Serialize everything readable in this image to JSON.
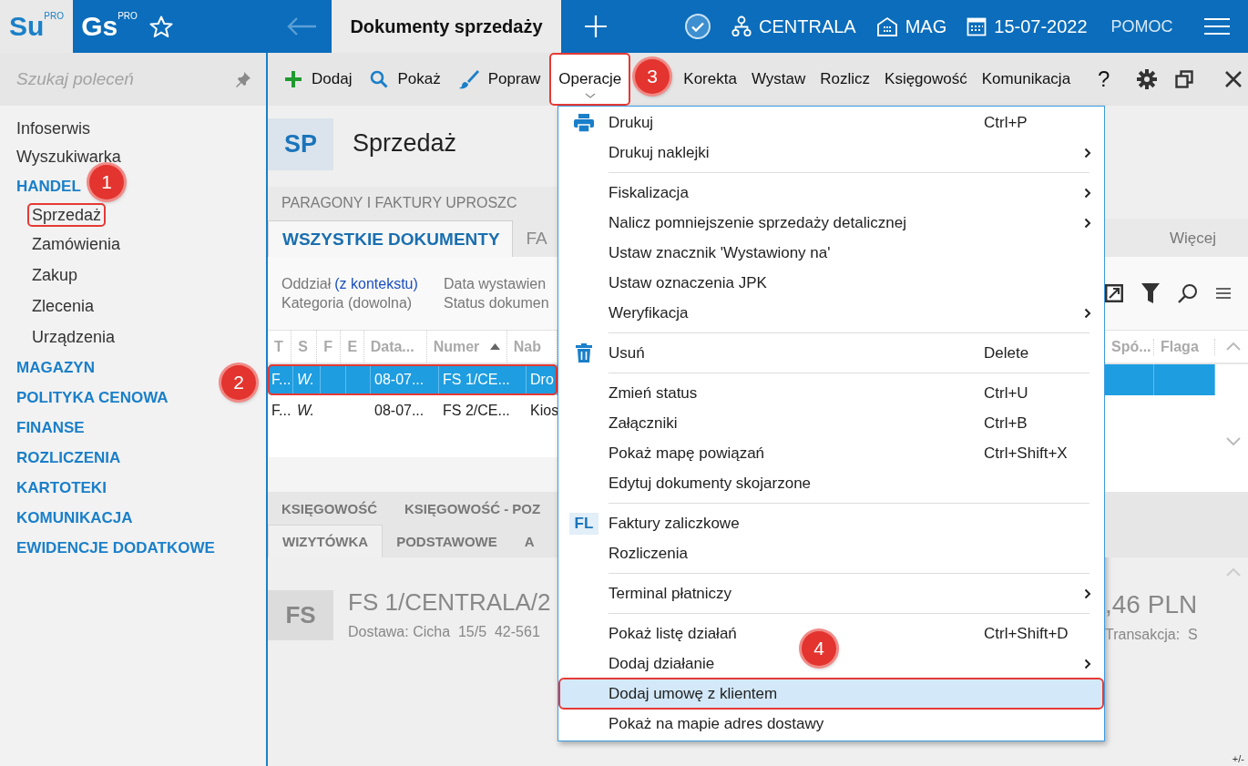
{
  "top_bar": {
    "logos": [
      {
        "text": "Su",
        "badge": "PRO"
      },
      {
        "text": "Gs",
        "badge": "PRO"
      }
    ],
    "tab": "Dokumenty sprzedaży",
    "context": [
      {
        "kind": "branch",
        "label": "CENTRALA"
      },
      {
        "kind": "warehouse",
        "label": "MAG"
      },
      {
        "kind": "date",
        "label": "15-07-2022"
      }
    ],
    "help": "POMOC"
  },
  "sidebar": {
    "search": {
      "placeholder": "Szukaj poleceń"
    },
    "items": [
      {
        "kind": "link",
        "label": "Infoserwis",
        "outlined": false
      },
      {
        "kind": "link",
        "label": "Wyszukiwarka",
        "outlined": false
      },
      {
        "kind": "section",
        "label": "HANDEL",
        "outlined": false,
        "children": [
          {
            "label": "Sprzedaż",
            "outlined": true
          },
          {
            "label": "Zamówienia",
            "outlined": false
          },
          {
            "label": "Zakup",
            "outlined": false
          },
          {
            "label": "Zlecenia",
            "outlined": false
          },
          {
            "label": "Urządzenia",
            "outlined": false
          }
        ]
      },
      {
        "kind": "section",
        "label": "MAGAZYN",
        "outlined": false
      },
      {
        "kind": "section",
        "label": "POLITYKA CENOWA",
        "outlined": false
      },
      {
        "kind": "section",
        "label": "FINANSE",
        "outlined": false
      },
      {
        "kind": "section",
        "label": "ROZLICZENIA",
        "outlined": false
      },
      {
        "kind": "section",
        "label": "KARTOTEKI",
        "outlined": false
      },
      {
        "kind": "section",
        "label": "KOMUNIKACJA",
        "outlined": false
      },
      {
        "kind": "section",
        "label": "EWIDENCJE DODATKOWE",
        "outlined": false
      }
    ]
  },
  "toolbar": {
    "actions": [
      {
        "label": "Dodaj",
        "open": false,
        "outlined": false
      },
      {
        "label": "Pokaż",
        "open": false,
        "outlined": false
      },
      {
        "label": "Popraw",
        "open": false,
        "outlined": false
      },
      {
        "label": "Operacje",
        "open": true,
        "outlined": true
      },
      {
        "label": "Korekta",
        "open": false,
        "outlined": false
      },
      {
        "label": "Wystaw",
        "open": false,
        "outlined": false
      },
      {
        "label": "Rozlicz",
        "open": false,
        "outlined": false
      },
      {
        "label": "Księgowość",
        "open": false,
        "outlined": false
      },
      {
        "label": "Komunikacja",
        "open": false,
        "outlined": false
      }
    ],
    "help": "?"
  },
  "header": {
    "badge": "SP",
    "title": "Sprzedaż"
  },
  "group_title": "PARAGONY I FAKTURY UPROSZC",
  "tabs": [
    {
      "label": "WSZYSTKIE DOKUMENTY",
      "selected": true
    },
    {
      "label": "FA",
      "selected": false
    }
  ],
  "tabs_right": [
    {
      "label": "Więcej",
      "selected": false
    }
  ],
  "filters": [
    {
      "label": "Oddział",
      "link": "(z kontekstu)"
    },
    {
      "label": "Data wystawien"
    },
    {
      "label": "Kategoria (dowolna)"
    },
    {
      "label": "Status dokumen"
    }
  ],
  "grid": {
    "columns": [
      {
        "label": "T",
        "sorted": false
      },
      {
        "label": "S",
        "sorted": false
      },
      {
        "label": "F",
        "sorted": false
      },
      {
        "label": "E",
        "sorted": false
      },
      {
        "label": "Data...",
        "sorted": false
      },
      {
        "label": "Numer",
        "sorted": true
      },
      {
        "label": "Nab",
        "sorted": false
      }
    ],
    "columns_right": [
      {
        "label": "Spó..."
      },
      {
        "label": "Flaga"
      }
    ],
    "rows": [
      {
        "type": "F...",
        "status": "W.",
        "date": "08-07...",
        "number": "FS 1/CE...",
        "buyer": "Dro",
        "selected": true,
        "outlined": true
      },
      {
        "type": "F...",
        "status": "W.",
        "date": "08-07...",
        "number": "FS 2/CE...",
        "buyer": "Kios",
        "selected": false,
        "outlined": false
      }
    ]
  },
  "detail_tabs": [
    [
      {
        "label": "KSIĘGOWOŚĆ",
        "selected": false
      },
      {
        "label": "KSIĘGOWOŚĆ - POZ",
        "selected": false
      }
    ],
    [
      {
        "label": "WIZYTÓWKA",
        "selected": true
      },
      {
        "label": "PODSTAWOWE",
        "selected": false
      },
      {
        "label": "A",
        "selected": false
      }
    ]
  ],
  "card": {
    "badge": "FS",
    "title": "FS 1/CENTRALA/2",
    "subtitle": "Dostawa: Cicha  15/5  42-561",
    "amount": ",46 PLN",
    "transaction": "Transakcja:  S"
  },
  "corner_label": "+/-",
  "menu": {
    "sections": [
      [
        {
          "label": "Drukuj",
          "kind": "print",
          "shortcut": "Ctrl+P",
          "submenu": false,
          "selected": false,
          "outlined": false
        },
        {
          "label": "Drukuj naklejki",
          "submenu": true,
          "selected": false,
          "outlined": false
        }
      ],
      [
        {
          "label": "Fiskalizacja",
          "submenu": true,
          "selected": false,
          "outlined": false
        },
        {
          "label": "Nalicz pomniejszenie sprzedaży detalicznej",
          "submenu": true,
          "selected": false,
          "outlined": false
        },
        {
          "label": "Ustaw znacznik 'Wystawiony na'",
          "submenu": false,
          "selected": false,
          "outlined": false
        },
        {
          "label": "Ustaw oznaczenia JPK",
          "submenu": false,
          "selected": false,
          "outlined": false
        },
        {
          "label": "Weryfikacja",
          "submenu": true,
          "selected": false,
          "outlined": false
        }
      ],
      [
        {
          "label": "Usuń",
          "kind": "delete",
          "shortcut": "Delete",
          "submenu": false,
          "selected": false,
          "outlined": false
        }
      ],
      [
        {
          "label": "Zmień status",
          "shortcut": "Ctrl+U",
          "submenu": false,
          "selected": false,
          "outlined": false
        },
        {
          "label": "Załączniki",
          "shortcut": "Ctrl+B",
          "submenu": false,
          "selected": false,
          "outlined": false
        },
        {
          "label": "Pokaż mapę powiązań",
          "shortcut": "Ctrl+Shift+X",
          "submenu": false,
          "selected": false,
          "outlined": false
        },
        {
          "label": "Edytuj dokumenty skojarzone",
          "submenu": false,
          "selected": false,
          "outlined": false
        }
      ],
      [
        {
          "label": "Faktury zaliczkowe",
          "badge": "FL",
          "submenu": false,
          "selected": false,
          "outlined": false
        },
        {
          "label": "Rozliczenia",
          "submenu": false,
          "selected": false,
          "outlined": false
        }
      ],
      [
        {
          "label": "Terminal płatniczy",
          "submenu": true,
          "selected": false,
          "outlined": false
        }
      ],
      [
        {
          "label": "Pokaż listę działań",
          "shortcut": "Ctrl+Shift+D",
          "submenu": false,
          "selected": false,
          "outlined": false
        },
        {
          "label": "Dodaj działanie",
          "submenu": true,
          "selected": false,
          "outlined": false
        },
        {
          "label": "Dodaj umowę z klientem",
          "submenu": false,
          "selected": true,
          "outlined": true
        },
        {
          "label": "Pokaż na mapie adres dostawy",
          "submenu": false,
          "selected": false,
          "outlined": false
        }
      ]
    ]
  },
  "annotations": [
    "1",
    "2",
    "3",
    "4"
  ]
}
